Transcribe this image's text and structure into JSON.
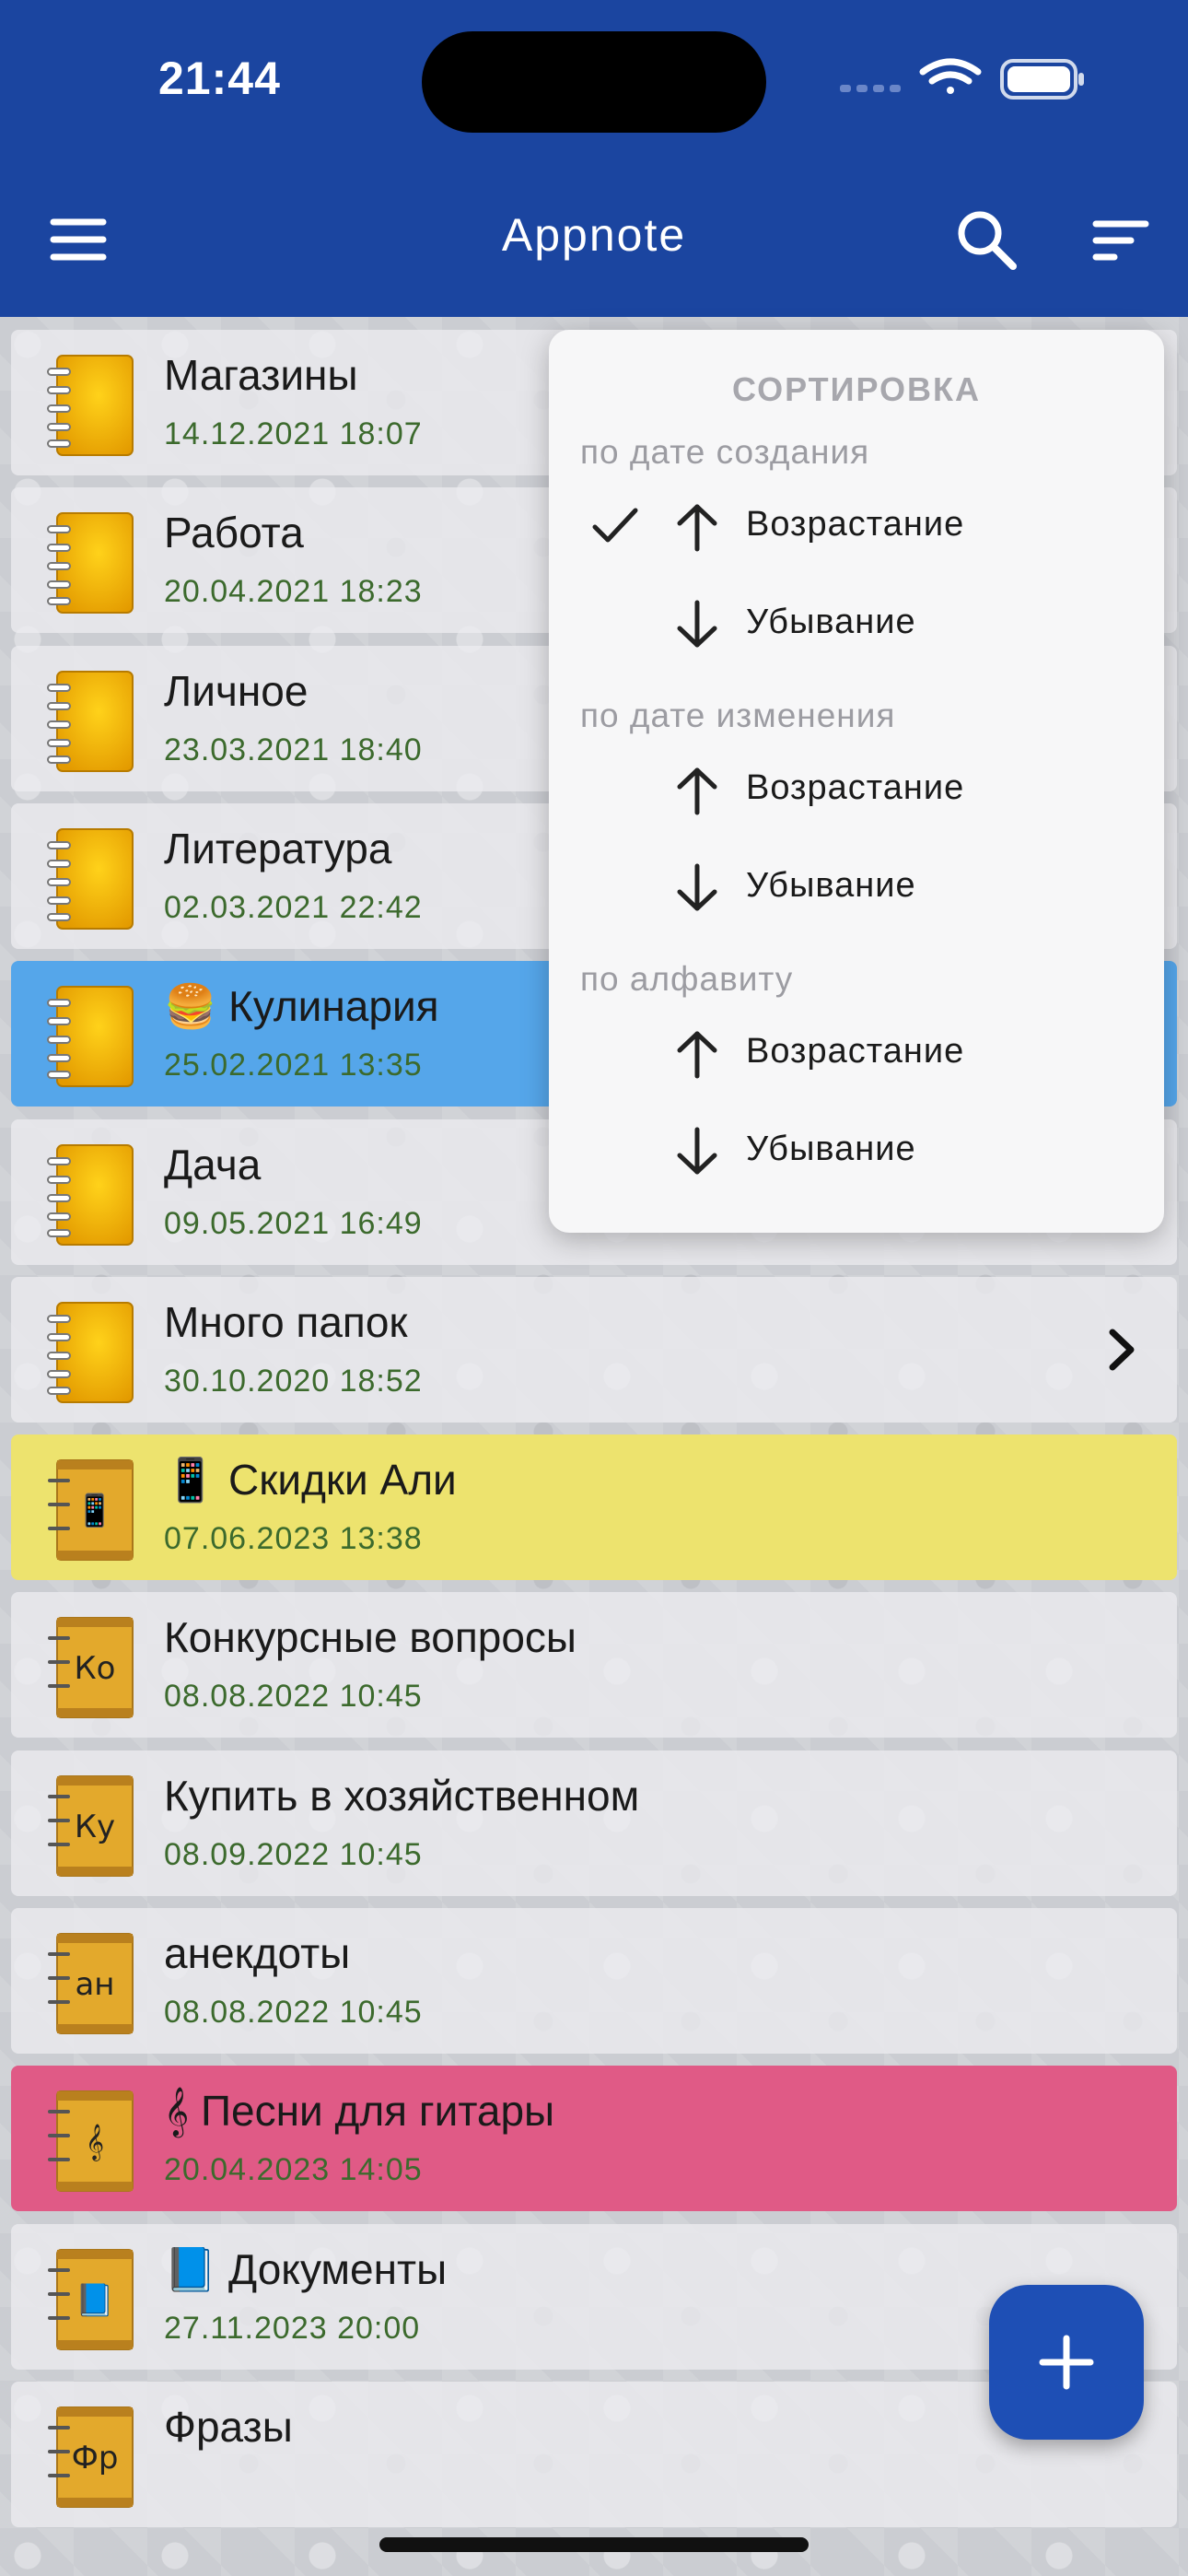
{
  "status": {
    "time": "21:44"
  },
  "header": {
    "title": "Appnote",
    "icons": {
      "menu": "menu-icon",
      "search": "search-icon",
      "sort": "sort-icon"
    }
  },
  "folders": [
    {
      "title": "Магазины",
      "date": "14.12.2021 18:07",
      "icon": "notebook-icon",
      "highlight": null
    },
    {
      "title": "Работа",
      "date": "20.04.2021 18:23",
      "icon": "notebook-icon",
      "highlight": null
    },
    {
      "title": "Личное",
      "date": "23.03.2021 18:40",
      "icon": "notebook-icon",
      "highlight": null
    },
    {
      "title": "Литература",
      "date": "02.03.2021 22:42",
      "icon": "notebook-icon",
      "highlight": null
    },
    {
      "title": "🍔 Кулинария",
      "date": "25.02.2021 13:35",
      "icon": "notebook-icon",
      "highlight": "#55a6ea"
    },
    {
      "title": "Дача",
      "date": "09.05.2021 16:49",
      "icon": "notebook-icon",
      "highlight": null
    },
    {
      "title": "Много папок",
      "date": "30.10.2020 18:52",
      "icon": "notebook-icon",
      "highlight": null,
      "chevron": true
    },
    {
      "title": "📱 Скидки Али",
      "date": "07.06.2023 13:38",
      "icon": "note-icon",
      "badge": "📱",
      "highlight": "#ede36e"
    },
    {
      "title": "Конкурсные вопросы",
      "date": "08.08.2022 10:45",
      "icon": "note-icon",
      "badge": "Ко",
      "highlight": null
    },
    {
      "title": "Купить в хозяйственном",
      "date": "08.09.2022 10:45",
      "icon": "note-icon",
      "badge": "Ку",
      "highlight": null
    },
    {
      "title": "анекдоты",
      "date": "08.08.2022 10:45",
      "icon": "note-icon",
      "badge": "ан",
      "highlight": null
    },
    {
      "title": "𝄞 Песни для гитары",
      "date": "20.04.2023 14:05",
      "icon": "note-icon",
      "badge": "𝄞",
      "highlight": "#e05a86"
    },
    {
      "title": "📘 Документы",
      "date": "27.11.2023 20:00",
      "icon": "note-icon",
      "badge": "📘",
      "highlight": null
    },
    {
      "title": "Фразы",
      "date": "",
      "icon": "note-icon",
      "badge": "Фр",
      "highlight": null
    }
  ],
  "sort_menu": {
    "title": "СОРТИРОВКА",
    "groups": [
      {
        "label": "по дате создания",
        "options": [
          {
            "label": "Возрастание",
            "dir": "up",
            "checked": true
          },
          {
            "label": "Убывание",
            "dir": "down",
            "checked": false
          }
        ]
      },
      {
        "label": "по дате изменения",
        "options": [
          {
            "label": "Возрастание",
            "dir": "up",
            "checked": false
          },
          {
            "label": "Убывание",
            "dir": "down",
            "checked": false
          }
        ]
      },
      {
        "label": "по алфавиту",
        "options": [
          {
            "label": "Возрастание",
            "dir": "up",
            "checked": false
          },
          {
            "label": "Убывание",
            "dir": "down",
            "checked": false
          }
        ]
      }
    ]
  },
  "fab": {
    "icon": "plus-icon"
  },
  "colors": {
    "header": "#1b45a0",
    "accent": "#1e4fb5",
    "date": "#3c6a2d",
    "notebook": "#f0b400"
  }
}
